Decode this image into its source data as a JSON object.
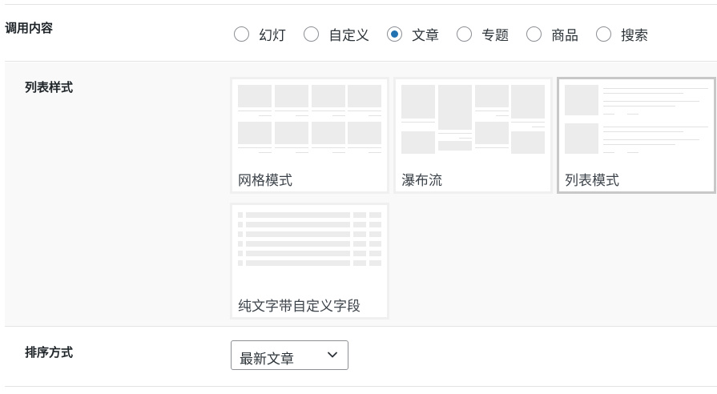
{
  "call_content": {
    "label": "调用内容",
    "options": [
      "幻灯",
      "自定义",
      "文章",
      "专题",
      "商品",
      "搜索"
    ],
    "selected": "文章"
  },
  "list_style": {
    "label": "列表样式",
    "cards": [
      "网格模式",
      "瀑布流",
      "列表模式",
      "纯文字带自定义字段"
    ],
    "selected": "列表模式"
  },
  "sort": {
    "label": "排序方式",
    "value": "最新文章"
  }
}
